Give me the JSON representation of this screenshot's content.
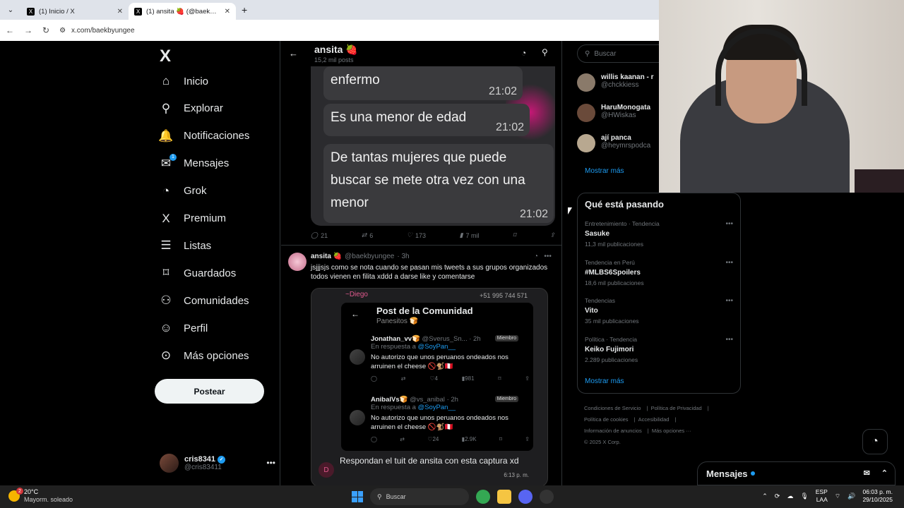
{
  "browser": {
    "tab1": "(1) Inicio / X",
    "tab2": "(1) ansita 🍓 (@baekbyungee)",
    "url": "x.com/baekbyungee"
  },
  "nav": {
    "logo": "X",
    "items": [
      {
        "label": "Inicio",
        "icon": "home-icon",
        "glyph": "⌂"
      },
      {
        "label": "Explorar",
        "icon": "search-icon",
        "glyph": "⚲"
      },
      {
        "label": "Notificaciones",
        "icon": "bell-icon",
        "glyph": "🔔"
      },
      {
        "label": "Mensajes",
        "icon": "envelope-icon",
        "glyph": "✉",
        "badge": "1"
      },
      {
        "label": "Grok",
        "icon": "grok-icon",
        "glyph": "◔"
      },
      {
        "label": "Premium",
        "icon": "x-icon",
        "glyph": "X"
      },
      {
        "label": "Listas",
        "icon": "list-icon",
        "glyph": "☰"
      },
      {
        "label": "Guardados",
        "icon": "bookmark-icon",
        "glyph": "⌑"
      },
      {
        "label": "Comunidades",
        "icon": "people-icon",
        "glyph": "⚇"
      },
      {
        "label": "Perfil",
        "icon": "person-icon",
        "glyph": "☺"
      },
      {
        "label": "Más opciones",
        "icon": "more-circle-icon",
        "glyph": "⊙"
      }
    ],
    "post_label": "Postear"
  },
  "account": {
    "name": "cris8341",
    "handle": "@cris83411"
  },
  "profile": {
    "name": "ansita 🍓",
    "posts": "15,2 mil posts"
  },
  "chat": [
    {
      "text": "enfermo",
      "time": "21:02"
    },
    {
      "text": "Es una menor de edad",
      "time": "21:02"
    },
    {
      "text": "De tantas mujeres que puede buscar se mete otra vez con una menor",
      "time": "21:02"
    }
  ],
  "tweet1_actions": {
    "replies": "21",
    "retweets": "6",
    "likes": "173",
    "views": "7 mil"
  },
  "tweet2": {
    "name": "ansita 🍓",
    "handle": "@baekbyungee",
    "time": "· 3h",
    "text": "jsjjjsjs como se nota cuando se pasan mis tweets a sus grupos organizados todos vienen en filita xddd a darse like y comentarse"
  },
  "screenshot": {
    "sender": "~Diego",
    "phone": "+51 995 744 571",
    "title": "Post de la Comunidad",
    "subtitle": "Panesitos 🍞",
    "replies": [
      {
        "name": "Jonathan_vv🍞",
        "handle": "@Sverus_Sn...",
        "time": "· 2h",
        "tag": "Miembro",
        "reply_to": "En respuesta a",
        "reply_handle": "@SoyPan__",
        "text": "No autorizo que unos peruanos ondeados nos arruinen el cheese 🚫🐒🇵🇪",
        "likes": "4",
        "views": "981"
      },
      {
        "name": "AnibalVs🍞",
        "handle": "@vs_anibal",
        "time": "· 2h",
        "tag": "Miembro",
        "reply_to": "En respuesta a",
        "reply_handle": "@SoyPan__",
        "text": "No autorizo que unos peruanos ondeados nos arruinen el cheese 🚫🐒🇵🇪",
        "likes": "24",
        "views": "2.9K"
      }
    ],
    "message": "Respondan el tuit de ansita con esta captura xd",
    "msg_time": "6:13 p. m.",
    "avatar_letter": "D"
  },
  "right": {
    "search_placeholder": "Buscar",
    "who": [
      {
        "name": "willis kaanan - r",
        "handle": "@chckkiess",
        "color": "#8a7a6a"
      },
      {
        "name": "HaruMonogata",
        "handle": "@HWiskas",
        "color": "#6a4a3a"
      },
      {
        "name": "ají panca",
        "handle": "@heymrspodca",
        "color": "#b8a890"
      }
    ],
    "show_more": "Mostrar más",
    "trends_title": "Qué está pasando",
    "trends": [
      {
        "category": "Entretenimiento · Tendencia",
        "name": "Sasuke",
        "count": "11,3 mil publicaciones"
      },
      {
        "category": "Tendencia en Perú",
        "name": "#MLBS6Spoilers",
        "count": "18,6 mil publicaciones"
      },
      {
        "category": "Tendencias",
        "name": "Vito",
        "count": "35 mil publicaciones"
      },
      {
        "category": "Política · Tendencia",
        "name": "Keiko Fujimori",
        "count": "2.289 publicaciones"
      }
    ],
    "trends_more": "Mostrar más",
    "footer": [
      "Condiciones de Servicio",
      "Política de Privacidad",
      "Política de cookies",
      "Accesibilidad",
      "Información de anuncios",
      "Más opciones ···",
      "© 2025 X Corp."
    ],
    "messages_label": "Mensajes"
  },
  "taskbar": {
    "temp": "20°C",
    "weather": "Mayorm. soleado",
    "weather_badge": "2",
    "search": "Buscar",
    "lang1": "ESP",
    "lang2": "LAA",
    "time": "06:03 p. m.",
    "date": "29/10/2025"
  }
}
